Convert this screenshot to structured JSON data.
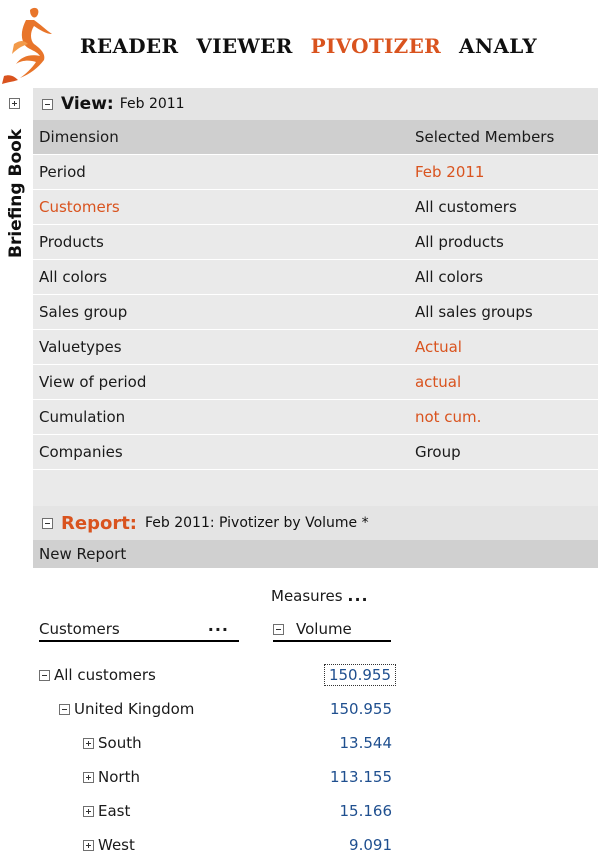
{
  "nav": {
    "items": [
      {
        "label": "READER",
        "active": false
      },
      {
        "label": "VIEWER",
        "active": false
      },
      {
        "label": "PIVOTIZER",
        "active": true
      },
      {
        "label": "ANALY",
        "active": false
      }
    ]
  },
  "sidebar": {
    "label": "Briefing Book"
  },
  "view": {
    "title": "View:",
    "subtitle": "Feb 2011",
    "columns": [
      "Dimension",
      "Selected Members"
    ],
    "rows": [
      {
        "dimension": "Period",
        "member": "Feb 2011"
      },
      {
        "dimension": "Customers",
        "member": "All customers"
      },
      {
        "dimension": "Products",
        "member": "All products"
      },
      {
        "dimension": "All colors",
        "member": "All colors"
      },
      {
        "dimension": "Sales group",
        "member": "All sales groups"
      },
      {
        "dimension": "Valuetypes",
        "member": "Actual"
      },
      {
        "dimension": "View of period",
        "member": "actual"
      },
      {
        "dimension": "Cumulation",
        "member": "not cum."
      },
      {
        "dimension": "Companies",
        "member": "Group"
      }
    ]
  },
  "report": {
    "title": "Report:",
    "subtitle": "Feb 2011: Pivotizer by Volume *",
    "bar_label": "New Report",
    "measures_label": "Measures",
    "more": "...",
    "row_header": "Customers",
    "measure": "Volume",
    "rows": [
      {
        "label": "All customers",
        "value": "150.955"
      },
      {
        "label": "United Kingdom",
        "value": "150.955"
      },
      {
        "label": "South",
        "value": "13.544"
      },
      {
        "label": "North",
        "value": "113.155"
      },
      {
        "label": "East",
        "value": "15.166"
      },
      {
        "label": "West",
        "value": "9.091"
      }
    ]
  },
  "colors": {
    "accent": "#d9531e",
    "value": "#1f4f8f"
  }
}
